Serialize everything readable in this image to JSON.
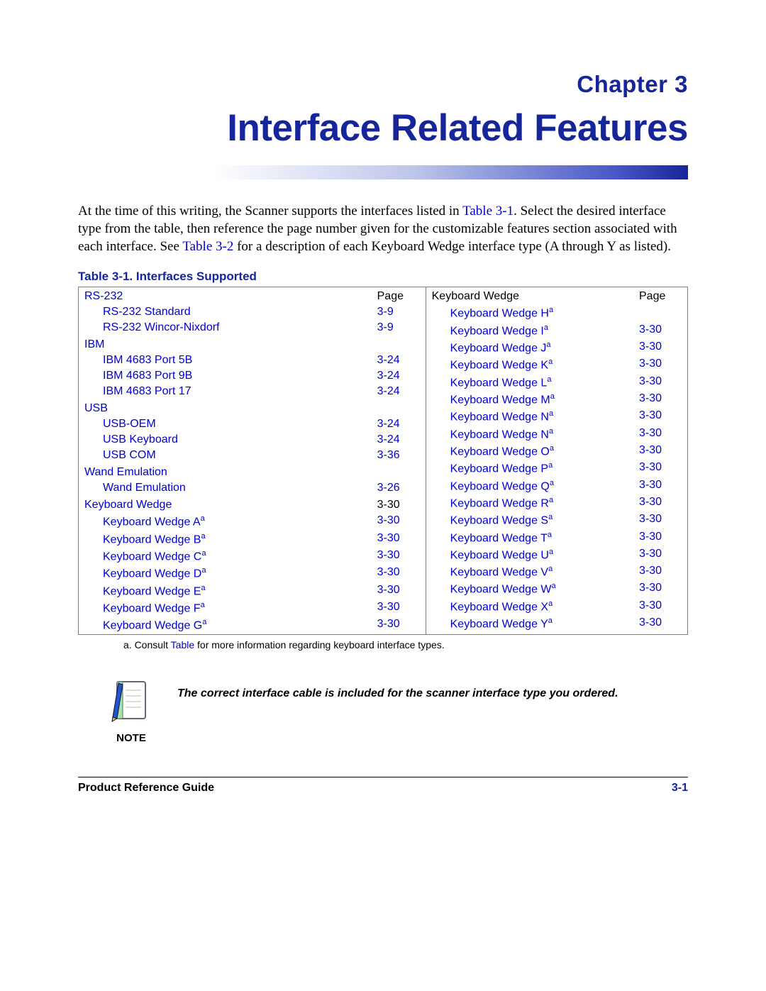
{
  "chapter": {
    "label": "Chapter 3",
    "title": "Interface Related Features"
  },
  "intro": {
    "part1": "At the time of this writing, the Scanner supports the interfaces listed in ",
    "xref1": "Table 3-1",
    "part2": ". Select the desired interface type from the table, then reference the page number given for the customizable features section associated with each interface. See ",
    "xref2": "Table 3-2",
    "part3": " for a description of each Keyboard Wedge interface type (A through Y as listed)."
  },
  "table": {
    "caption": "Table 3-1. Interfaces Supported",
    "page_label": "Page",
    "left": {
      "groups": [
        {
          "name": "RS-232",
          "rows": [
            {
              "label": "RS-232 Standard",
              "page": "3-9"
            },
            {
              "label": "RS-232 Wincor-Nixdorf",
              "page": "3-9"
            }
          ]
        },
        {
          "name": "IBM",
          "rows": [
            {
              "label": "IBM 4683 Port 5B",
              "page": "3-24"
            },
            {
              "label": "IBM 4683 Port 9B",
              "page": "3-24"
            },
            {
              "label": "IBM 4683 Port 17",
              "page": "3-24"
            }
          ]
        },
        {
          "name": "USB",
          "rows": [
            {
              "label": "USB-OEM",
              "page": "3-24"
            },
            {
              "label": "USB Keyboard",
              "page": "3-24"
            },
            {
              "label": "USB COM",
              "page": "3-36"
            }
          ]
        },
        {
          "name": "Wand Emulation",
          "rows": [
            {
              "label": "Wand Emulation",
              "page": "3-26"
            }
          ]
        },
        {
          "name": "Keyboard Wedge",
          "name_page": "3-30",
          "rows_footnote": true,
          "rows": [
            {
              "label": "Keyboard Wedge A",
              "page": "3-30"
            },
            {
              "label": "Keyboard Wedge B",
              "page": "3-30"
            },
            {
              "label": "Keyboard Wedge C",
              "page": "3-30"
            },
            {
              "label": "Keyboard Wedge D",
              "page": "3-30"
            },
            {
              "label": "Keyboard Wedge E",
              "page": "3-30"
            },
            {
              "label": "Keyboard Wedge F",
              "page": "3-30"
            },
            {
              "label": "Keyboard Wedge G",
              "page": "3-30"
            }
          ]
        }
      ]
    },
    "right": {
      "header": "Keyboard Wedge",
      "rows": [
        {
          "label": "Keyboard Wedge H",
          "page": ""
        },
        {
          "label": "Keyboard Wedge I",
          "page": "3-30"
        },
        {
          "label": "Keyboard Wedge J",
          "page": "3-30"
        },
        {
          "label": "Keyboard Wedge K",
          "page": "3-30"
        },
        {
          "label": "Keyboard Wedge L",
          "page": "3-30"
        },
        {
          "label": "Keyboard Wedge M",
          "page": "3-30"
        },
        {
          "label": "Keyboard Wedge N",
          "page": "3-30"
        },
        {
          "label": "Keyboard Wedge N",
          "page": "3-30"
        },
        {
          "label": "Keyboard Wedge O",
          "page": "3-30"
        },
        {
          "label": "Keyboard Wedge P",
          "page": "3-30"
        },
        {
          "label": "Keyboard Wedge Q",
          "page": "3-30"
        },
        {
          "label": "Keyboard Wedge R",
          "page": "3-30"
        },
        {
          "label": "Keyboard Wedge S",
          "page": "3-30"
        },
        {
          "label": "Keyboard Wedge T",
          "page": "3-30"
        },
        {
          "label": "Keyboard Wedge U",
          "page": "3-30"
        },
        {
          "label": "Keyboard Wedge V",
          "page": "3-30"
        },
        {
          "label": "Keyboard Wedge W",
          "page": "3-30"
        },
        {
          "label": "Keyboard Wedge X",
          "page": "3-30"
        },
        {
          "label": "Keyboard Wedge Y",
          "page": "3-30"
        }
      ]
    },
    "footnote_marker": "a",
    "footnote": {
      "prefix": "a. Consult ",
      "link": "Table",
      "suffix": "  for more information regarding keyboard  interface  types."
    }
  },
  "note": {
    "label": "NOTE",
    "text": "The correct interface cable is included for the scanner interface type you ordered."
  },
  "footer": {
    "left": "Product Reference Guide",
    "right": "3-1"
  }
}
